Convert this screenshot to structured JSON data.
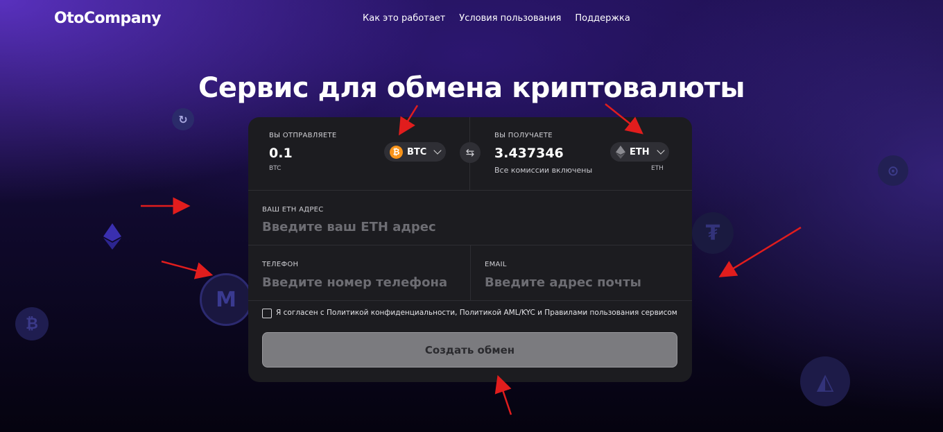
{
  "header": {
    "logo": "OtoCompany",
    "nav": [
      "Как это работает",
      "Условия пользования",
      "Поддержка"
    ]
  },
  "hero": {
    "title": "Сервис для обмена криптовалюты"
  },
  "exchange": {
    "send": {
      "label": "ВЫ ОТПРАВЛЯЕТЕ",
      "amount": "0.1",
      "currency_code": "BTC",
      "selector_label": "BTC",
      "icon": "bitcoin-icon"
    },
    "receive": {
      "label": "ВЫ ПОЛУЧАЕТЕ",
      "amount": "3.437346",
      "note": "Все комиссии включены",
      "currency_code": "ETH",
      "selector_label": "ETH",
      "icon": "ethereum-icon"
    },
    "swap_icon": "swap-icon"
  },
  "form": {
    "address": {
      "label": "ВАШ ETH АДРЕС",
      "placeholder": "Введите ваш ETH адрес"
    },
    "phone": {
      "label": "ТЕЛЕФОН",
      "placeholder": "Введите номер телефона"
    },
    "email": {
      "label": "EMAIL",
      "placeholder": "Введите адрес почты"
    },
    "agreement": "Я согласен с Политикой конфиденциальности, Политикой AML/KYC  и Правилами пользования сервисом",
    "submit": "Создать обмен"
  },
  "colors": {
    "accent_orange": "#f7931a",
    "card_bg": "#1c1c20",
    "button_bg": "#7b7b7f",
    "annotation_red": "#e11d1d"
  }
}
